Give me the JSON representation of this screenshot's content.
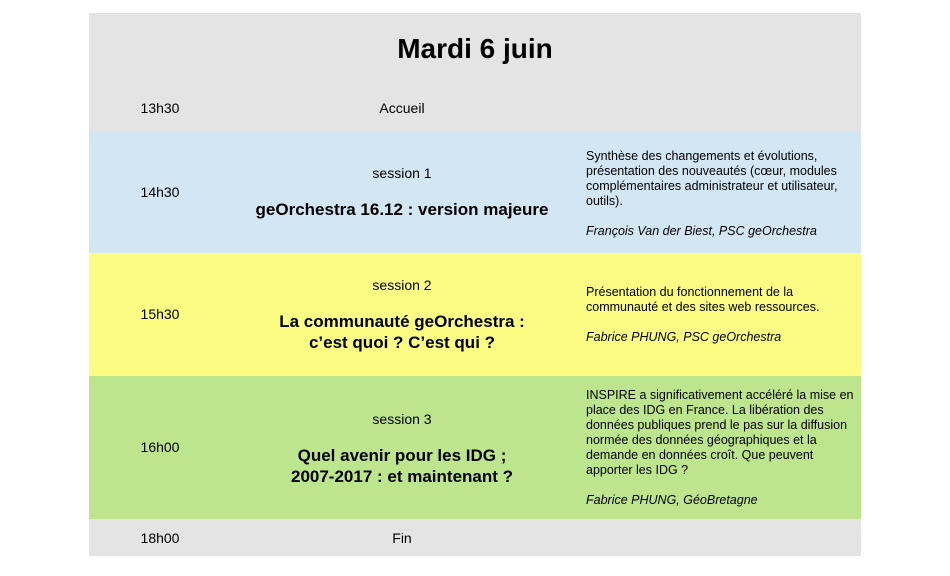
{
  "title": "Mardi 6 juin",
  "welcome": {
    "time": "13h30",
    "label": "Accueil"
  },
  "sessions": [
    {
      "time": "14h30",
      "label": "session 1",
      "title_lines": [
        "geOrchestra 16.12 : version majeure"
      ],
      "description": "Synthèse des changements et évolutions, présentation des nouveautés (cœur, modules complémentaires administrateur et utilisateur, outils).",
      "speaker": "François Van der Biest, PSC geOrchestra",
      "color": "#d3e6f4"
    },
    {
      "time": "15h30",
      "label": "session 2",
      "title_lines": [
        "La communauté geOrchestra :",
        "c’est quoi ? C’est qui ?"
      ],
      "description": "Présentation du fonctionnement de la communauté et des sites web ressources.",
      "speaker": "Fabrice PHUNG, PSC geOrchestra",
      "color": "#fbfc83"
    },
    {
      "time": "16h00",
      "label": "session 3",
      "title_lines": [
        "Quel avenir pour les IDG ;",
        "2007-2017 : et maintenant ?"
      ],
      "description": "INSPIRE a significativement accéléré la mise en place des IDG en France. La libération des données publiques prend le pas sur la diffusion normée des données géographiques et la demande en données croît. Que peuvent apporter les IDG ?",
      "speaker": "Fabrice PHUNG, GéoBretagne",
      "color": "#bde58e"
    }
  ],
  "closing": {
    "time": "18h00",
    "label": "Fin"
  }
}
